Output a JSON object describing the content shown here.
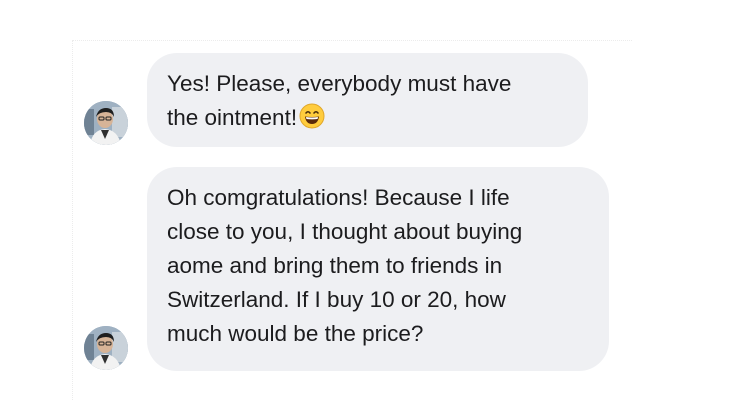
{
  "messages": [
    {
      "lines": [
        "Yes! Please, everybody must have",
        "the ointment!"
      ],
      "emoji": "grinning-face-with-smiling-eyes"
    },
    {
      "lines": [
        "Oh comgratulations! Because I life",
        "close to you, I thought about buying",
        "aome and bring them to friends in",
        "Switzerland. If I buy 10 or 20, how",
        "much would be the price?"
      ]
    }
  ],
  "colors": {
    "bubble": "#eff0f3",
    "text": "#1c1c1e"
  }
}
